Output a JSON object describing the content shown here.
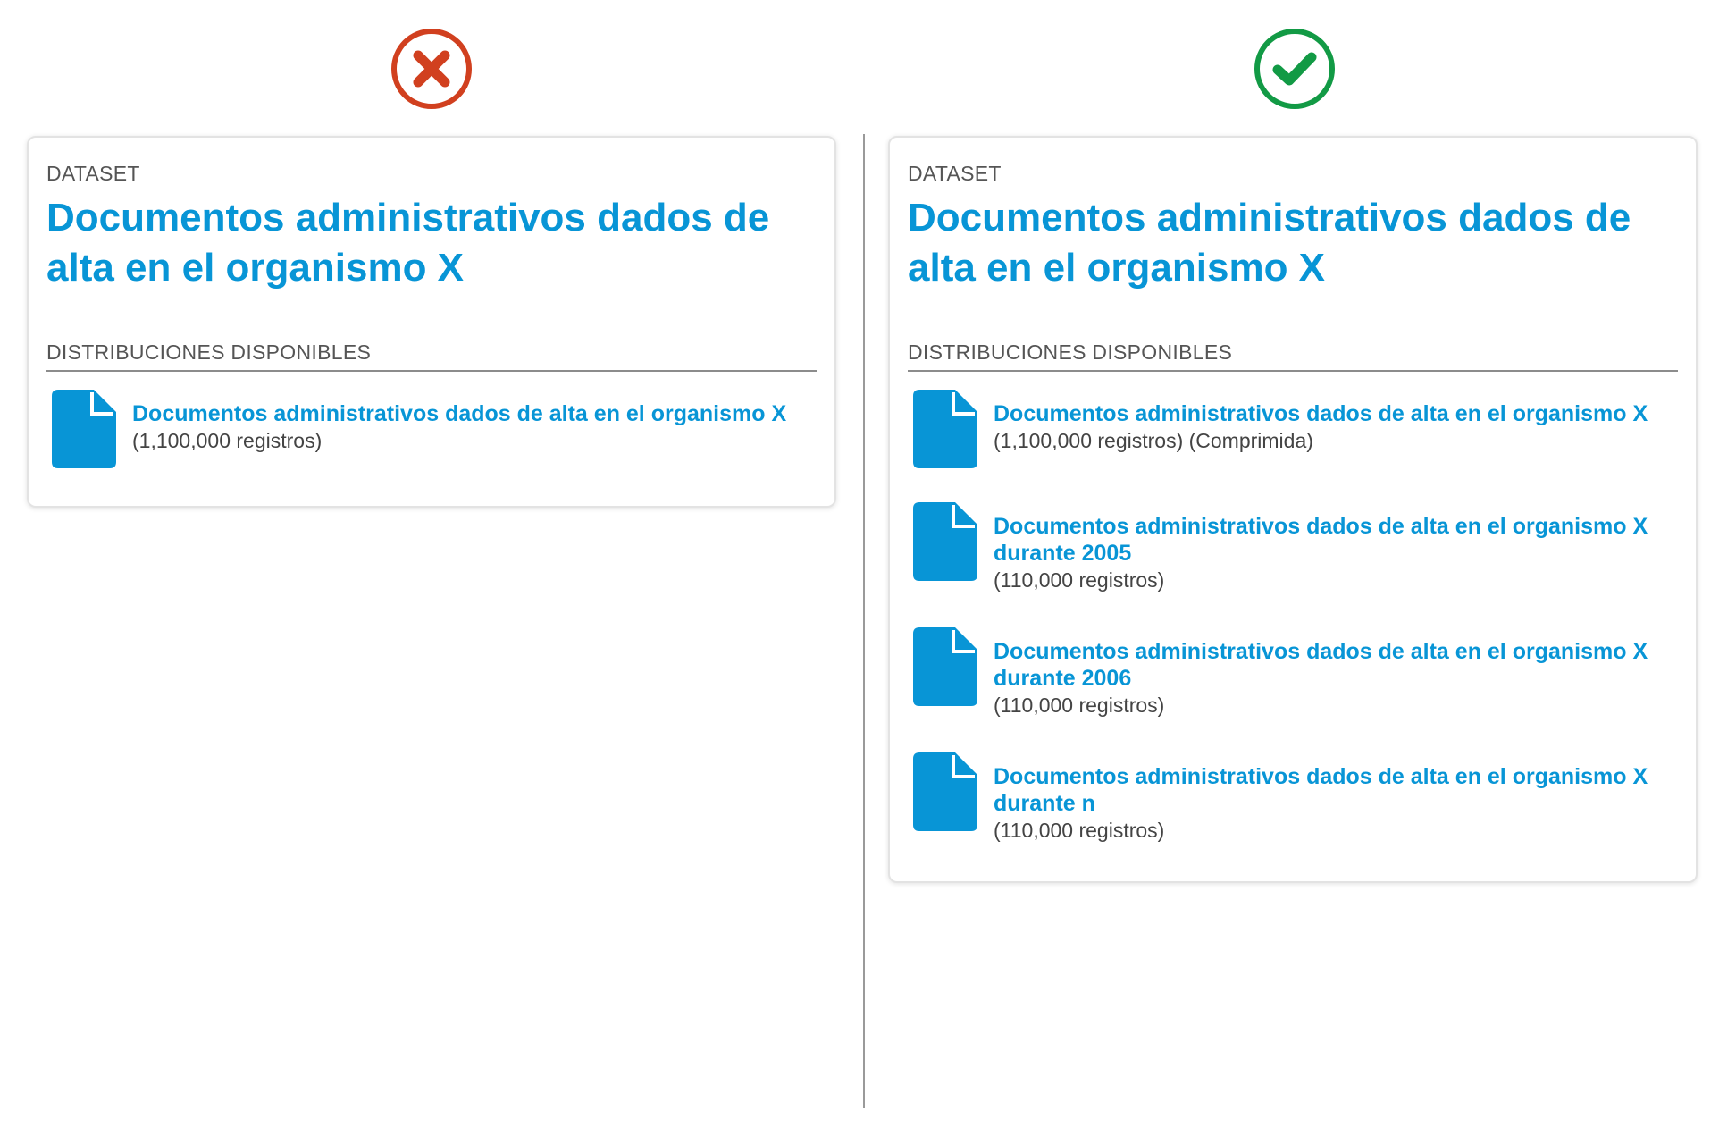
{
  "colors": {
    "accent": "#0895d6",
    "bad": "#d1401f",
    "good": "#129a45",
    "text_muted": "#555555"
  },
  "left": {
    "status_icon": "x-circle-icon",
    "kicker": "DATASET",
    "title": "Documentos administrativos dados de alta en el organismo X",
    "section_label": "DISTRIBUCIONES DISPONIBLES",
    "distributions": [
      {
        "title": "Documentos administrativos dados de alta en el organismo X",
        "meta": "(1,100,000 registros)",
        "icon": "file-icon"
      }
    ]
  },
  "right": {
    "status_icon": "check-circle-icon",
    "kicker": "DATASET",
    "title": "Documentos administrativos dados de alta en el organismo X",
    "section_label": "DISTRIBUCIONES DISPONIBLES",
    "distributions": [
      {
        "title": "Documentos administrativos dados de alta en el organismo X",
        "meta": "(1,100,000 registros) (Comprimida)",
        "icon": "file-icon"
      },
      {
        "title": "Documentos administrativos dados de alta en el organismo X durante 2005",
        "meta": "(110,000 registros)",
        "icon": "file-icon"
      },
      {
        "title": "Documentos administrativos dados de alta en el organismo X durante 2006",
        "meta": "(110,000 registros)",
        "icon": "file-icon"
      },
      {
        "title": "Documentos administrativos dados de alta en el organismo X durante n",
        "meta": "(110,000 registros)",
        "icon": "file-icon"
      }
    ]
  }
}
